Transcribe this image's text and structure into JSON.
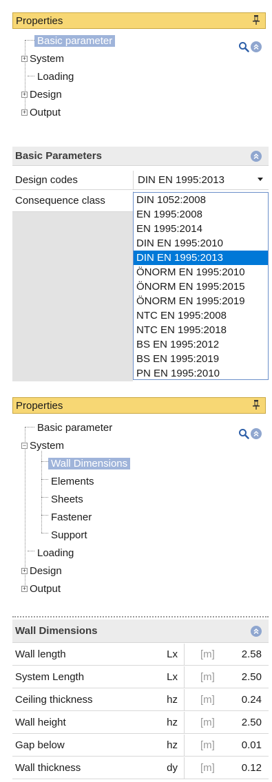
{
  "props1": {
    "title": "Properties",
    "tree": [
      "Basic parameter",
      "System",
      "Loading",
      "Design",
      "Output"
    ]
  },
  "basic": {
    "title": "Basic Parameters",
    "rows": [
      {
        "key": "Design codes",
        "value": "DIN EN 1995:2013"
      },
      {
        "key": "Consequence class",
        "value": ""
      }
    ],
    "options": [
      "DIN 1052:2008",
      "EN 1995:2008",
      "EN 1995:2014",
      "DIN EN 1995:2010",
      "DIN EN 1995:2013",
      "ÖNORM EN 1995:2010",
      "ÖNORM EN 1995:2015",
      "ÖNORM EN 1995:2019",
      "NTC EN 1995:2008",
      "NTC EN 1995:2018",
      "BS EN 1995:2012",
      "BS EN 1995:2019",
      "PN EN 1995:2010"
    ],
    "selected_index": 4
  },
  "props2": {
    "title": "Properties",
    "tree": [
      "Basic parameter",
      "System",
      "Wall Dimensions",
      "Elements",
      "Sheets",
      "Fastener",
      "Support",
      "Loading",
      "Design",
      "Output"
    ]
  },
  "wall": {
    "title": "Wall Dimensions",
    "rows": [
      {
        "name": "Wall length",
        "sym": "Lx",
        "unit": "[m]",
        "value": "2.58"
      },
      {
        "name": "System Length",
        "sym": "Lx",
        "unit": "[m]",
        "value": "2.50"
      },
      {
        "name": "Ceiling thickness",
        "sym": "hz",
        "unit": "[m]",
        "value": "0.24"
      },
      {
        "name": "Wall height",
        "sym": "hz",
        "unit": "[m]",
        "value": "2.50"
      },
      {
        "name": "Gap below",
        "sym": "hz",
        "unit": "[m]",
        "value": "0.01"
      },
      {
        "name": "Wall thickness",
        "sym": "dy",
        "unit": "[m]",
        "value": "0.12"
      }
    ]
  },
  "colors": {
    "header_yellow": "#f7d774",
    "selection_blue": "#9fb4da",
    "list_selection": "#0078d7"
  }
}
